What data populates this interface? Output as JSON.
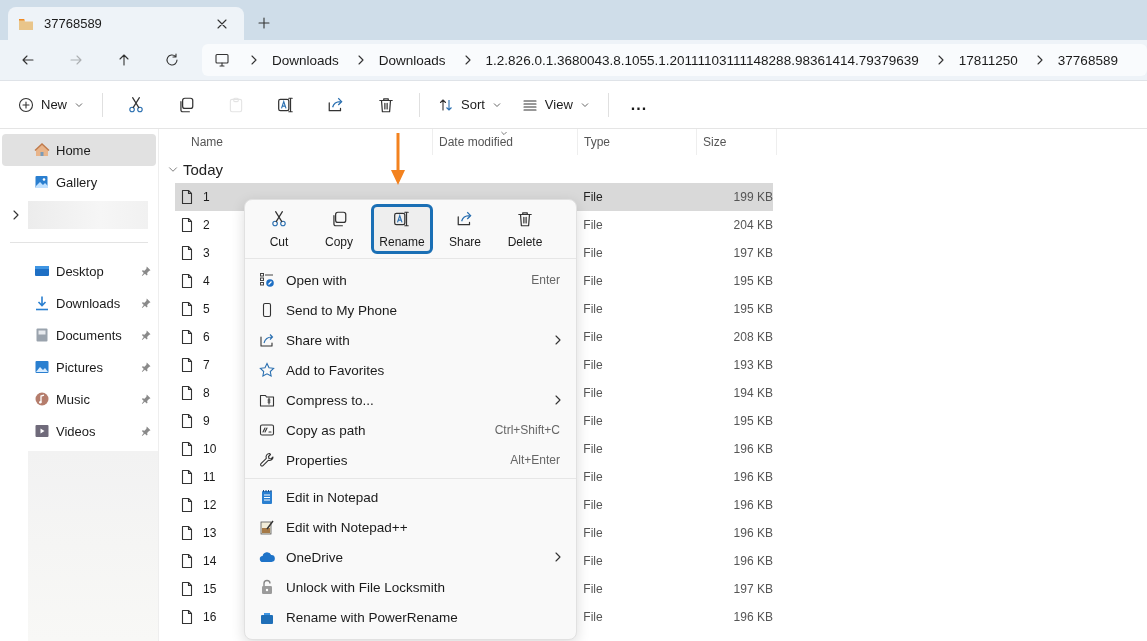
{
  "window": {
    "tabs": [
      {
        "title": "37768589",
        "selected": true
      }
    ]
  },
  "navigation": {
    "back": {
      "disabled": false
    },
    "forward": {
      "disabled": true
    },
    "breadcrumbs": [
      "Downloads",
      "Downloads",
      "1.2.826.0.1.3680043.8.1055.1.20111103111148288.98361414.79379639",
      "17811250",
      "37768589"
    ]
  },
  "command_bar": {
    "new_label": "New",
    "tools": [
      {
        "disabled": false
      },
      {
        "disabled": false
      },
      {
        "disabled": true
      },
      {
        "disabled": false
      },
      {
        "disabled": false
      },
      {
        "disabled": false
      }
    ],
    "sort_label": "Sort",
    "view_label": "View",
    "more": "..."
  },
  "sidebar": {
    "top_items": [
      {
        "label": "Home",
        "selected": true
      },
      {
        "label": "Gallery",
        "selected": false
      }
    ],
    "quick_access": [
      {
        "label": "Desktop",
        "pinned": true
      },
      {
        "label": "Downloads",
        "pinned": true
      },
      {
        "label": "Documents",
        "pinned": true
      },
      {
        "label": "Pictures",
        "pinned": true
      },
      {
        "label": "Music",
        "pinned": true
      },
      {
        "label": "Videos",
        "pinned": true
      }
    ]
  },
  "file_list": {
    "columns": [
      "Name",
      "Date modified",
      "Type",
      "Size"
    ],
    "group": "Today",
    "rows": [
      {
        "name": "1",
        "type": "File",
        "size": "199 KB",
        "selected": true
      },
      {
        "name": "2",
        "type": "File",
        "size": "204 KB",
        "selected": false
      },
      {
        "name": "3",
        "type": "File",
        "size": "197 KB",
        "selected": false
      },
      {
        "name": "4",
        "type": "File",
        "size": "195 KB",
        "selected": false
      },
      {
        "name": "5",
        "type": "File",
        "size": "195 KB",
        "selected": false
      },
      {
        "name": "6",
        "type": "File",
        "size": "208 KB",
        "selected": false
      },
      {
        "name": "7",
        "type": "File",
        "size": "193 KB",
        "selected": false
      },
      {
        "name": "8",
        "type": "File",
        "size": "194 KB",
        "selected": false
      },
      {
        "name": "9",
        "type": "File",
        "size": "195 KB",
        "selected": false
      },
      {
        "name": "10",
        "type": "File",
        "size": "196 KB",
        "selected": false
      },
      {
        "name": "11",
        "type": "File",
        "size": "196 KB",
        "selected": false
      },
      {
        "name": "12",
        "type": "File",
        "size": "196 KB",
        "selected": false
      },
      {
        "name": "13",
        "type": "File",
        "size": "196 KB",
        "selected": false
      },
      {
        "name": "14",
        "type": "File",
        "size": "196 KB",
        "selected": false
      },
      {
        "name": "15",
        "type": "File",
        "size": "197 KB",
        "selected": false
      },
      {
        "name": "16",
        "type": "File",
        "size": "196 KB",
        "selected": false
      }
    ]
  },
  "context_menu": {
    "actions": [
      {
        "label": "Cut",
        "highlighted": false
      },
      {
        "label": "Copy",
        "highlighted": false
      },
      {
        "label": "Rename",
        "highlighted": true
      },
      {
        "label": "Share",
        "highlighted": false
      },
      {
        "label": "Delete",
        "highlighted": false
      }
    ],
    "items": [
      {
        "label": "Open with",
        "shortcut": "Enter",
        "submenu": false
      },
      {
        "label": "Send to My Phone",
        "submenu": false
      },
      {
        "label": "Share with",
        "submenu": true
      },
      {
        "label": "Add to Favorites",
        "submenu": false
      },
      {
        "label": "Compress to...",
        "submenu": true
      },
      {
        "label": "Copy as path",
        "shortcut": "Ctrl+Shift+C",
        "submenu": false
      },
      {
        "label": "Properties",
        "shortcut": "Alt+Enter",
        "submenu": false,
        "separator_after": true
      },
      {
        "label": "Edit in Notepad",
        "submenu": false
      },
      {
        "label": "Edit with Notepad++",
        "submenu": false
      },
      {
        "label": "OneDrive",
        "submenu": true
      },
      {
        "label": "Unlock with File Locksmith",
        "submenu": false
      },
      {
        "label": "Rename with PowerRename",
        "submenu": false
      }
    ]
  }
}
